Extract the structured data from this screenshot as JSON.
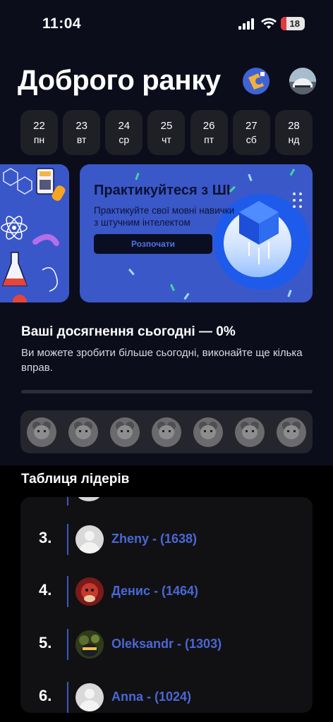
{
  "status": {
    "time": "11:04",
    "battery": "18",
    "battery_color": "#e5393f"
  },
  "header": {
    "greeting": "Доброго ранку",
    "badge_icon": "language-badge-icon",
    "avatar_icon": "profile-avatar"
  },
  "days": [
    {
      "num": "22",
      "wd": "пн"
    },
    {
      "num": "23",
      "wd": "вт"
    },
    {
      "num": "24",
      "wd": "ср"
    },
    {
      "num": "25",
      "wd": "чт"
    },
    {
      "num": "26",
      "wd": "пт"
    },
    {
      "num": "27",
      "wd": "сб"
    },
    {
      "num": "28",
      "wd": "нд"
    }
  ],
  "promo": {
    "title": "Практикуйтеся з ШІ",
    "subtitle": "Практикуйте свої мовні навички з штучним інтелектом",
    "button": "Розпочати"
  },
  "achievements": {
    "title": "Ваші досягнення сьогодні — 0%",
    "subtitle": "Ви можете зробити більше сьогодні, виконайте ще кілька вправ.",
    "progress": 0.0
  },
  "medals": [
    "bear-medal-1",
    "bear-medal-2",
    "bear-medal-3",
    "bear-medal-4",
    "bear-medal-5",
    "bear-medal-6",
    "bear-medal-7"
  ],
  "leaderboard": {
    "title": "Таблиця лідерів",
    "rows": [
      {
        "rank": "3.",
        "name": "Zheny - (1638)"
      },
      {
        "rank": "4.",
        "name": "Денис - (1464)"
      },
      {
        "rank": "5.",
        "name": "Oleksandr - (1303)"
      },
      {
        "rank": "6.",
        "name": "Anna - (1024)"
      }
    ]
  },
  "colors": {
    "background": "#0b0d1b",
    "accent": "#3b58c9",
    "name_link": "#4a67d6"
  }
}
